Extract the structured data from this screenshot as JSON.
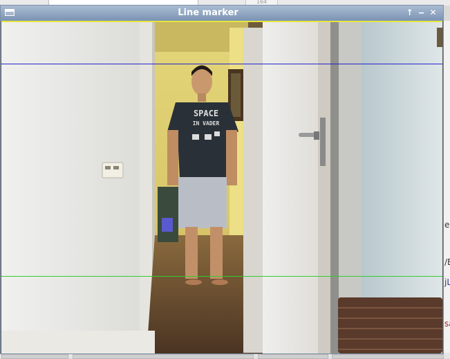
{
  "window": {
    "title": "Line marker",
    "buttons": {
      "maximize": "↑",
      "minimize": "‒",
      "close": "✕"
    }
  },
  "background": {
    "tab_text": "164",
    "right_fragments": [
      "e",
      "/E",
      "jL",
      "sa"
    ]
  },
  "video": {
    "shirt_text_line1": "SPACE",
    "shirt_text_line2": "IN VADER"
  },
  "marker_lines": [
    {
      "name": "top-line",
      "color": "#2222cc"
    },
    {
      "name": "bottom-line",
      "color": "#33cc33"
    }
  ],
  "colors": {
    "title_bar": "#8fa4c0",
    "frame_top": "#e8e84a"
  }
}
